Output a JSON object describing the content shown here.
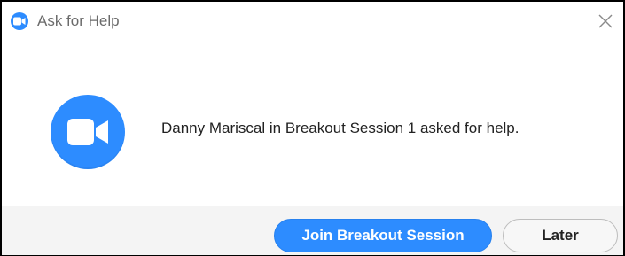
{
  "window": {
    "title": "Ask for Help",
    "icon": "zoom-camera-icon",
    "close_icon": "close-icon"
  },
  "message": {
    "text": "Danny Mariscal in Breakout Session 1 asked for help.",
    "icon": "zoom-camera-icon"
  },
  "buttons": {
    "join_label": "Join Breakout Session",
    "later_label": "Later"
  },
  "colors": {
    "accent": "#2D8CFF",
    "footer_bg": "#f4f4f4",
    "title_text": "#6b6b6b"
  }
}
